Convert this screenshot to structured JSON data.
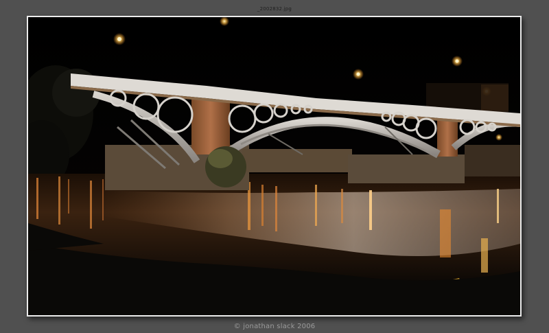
{
  "window": {
    "filename": "_2002832.jpg"
  },
  "photo": {
    "subject": "night-bridge-photo",
    "colors": {
      "sky": "#000000",
      "bridge_deck": "#e2e0dc",
      "lamp": "#ffd27a",
      "water_glow": "#e07a2a",
      "bank": "#0b0a08"
    }
  },
  "footer": {
    "credit": "© jonathan slack 2006"
  }
}
